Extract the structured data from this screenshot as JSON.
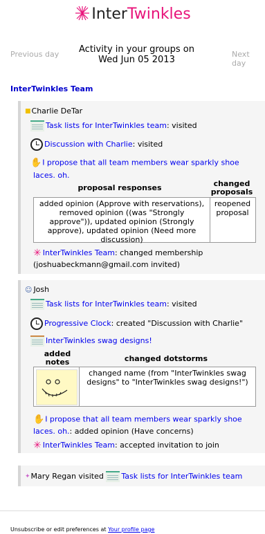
{
  "logo": {
    "part1": "Inter",
    "part2": "Twinkles"
  },
  "nav": {
    "previous": "Previous day",
    "next": "Next day"
  },
  "activity": {
    "line1": "Activity in your groups on",
    "line2": "Wed Jun 05 2013"
  },
  "group": {
    "name": "InterTwinkles Team"
  },
  "users": {
    "charlie": {
      "name": "Charlie DeTar",
      "task_link": "Task lists for InterTwinkles team",
      "task_status": ":  visited",
      "discussion_link": "Discussion with Charlie",
      "discussion_status": ":  visited",
      "proposal_line1": "I propose that all team members wear sparkly shoe",
      "proposal_line2": "laces. oh.",
      "th_responses": "proposal responses",
      "th_changed1": "changed",
      "th_changed2": "proposals",
      "responses_text": [
        "added opinion (Approve with reservations),",
        "removed opinion ((was \"Strongly",
        "approve\")),  updated opinion (Strongly",
        "approve),  updated opinion (Need more",
        "discussion)"
      ],
      "changed_text": [
        "reopened",
        "proposal"
      ],
      "team_link": "InterTwinkles Team",
      "team_status": ":  changed membership",
      "team_detail": "(joshuabeckmann@gmail.com invited)"
    },
    "josh": {
      "name": "Josh",
      "task_link": "Task lists for InterTwinkles team",
      "task_status": ":  visited",
      "clock_link": "Progressive Clock",
      "clock_status": ":  created \"Discussion with Charlie\"",
      "swag_link": "InterTwinkles swag designs!",
      "th_added1": "added",
      "th_added2": "notes",
      "th_dotstorms": "changed dotstorms",
      "dotstorms_text": [
        "changed name (from \"InterTwinkles swag",
        "designs\" to \"InterTwinkles swag designs!\")"
      ],
      "proposal_line1": "I propose that all team members wear sparkly shoe",
      "proposal_line2_link": "laces. oh.",
      "proposal_line2_status": ":  added opinion (Have concerns)",
      "team_link": "InterTwinkles Team",
      "team_status": ":  accepted invitation to join"
    },
    "mary": {
      "name": "Mary Regan",
      "status": "  visited ",
      "task_link": "Task lists for InterTwinkles team"
    }
  },
  "footer": {
    "text": "Unsubscribe or edit preferences at ",
    "link": "Your profile page"
  },
  "colors": {
    "brand_pink": "#e8137a",
    "link_blue": "#0000ee",
    "block_bg": "#f5f5f5"
  }
}
